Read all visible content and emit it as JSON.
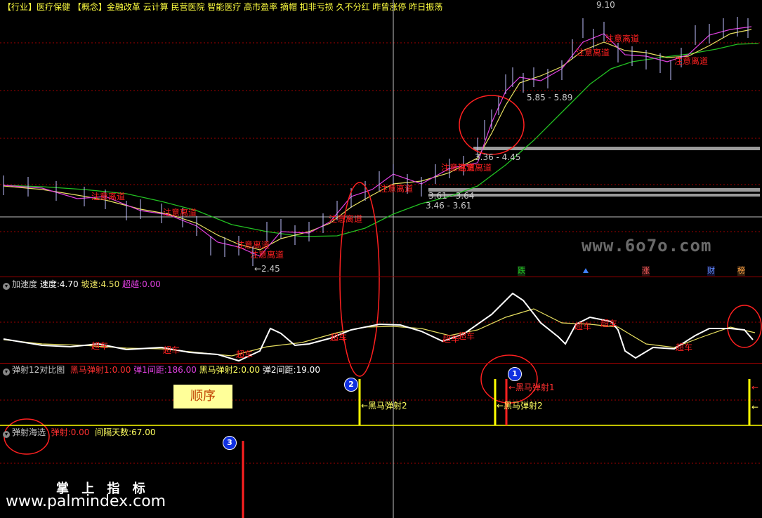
{
  "header": {
    "industry_tag": "【行业】",
    "industry": "医疗保健",
    "concept_tag": "【概念】",
    "concepts": "金融改革 云计算 民营医院 智能医疗 高市盈率 摘帽 扣非亏损 久不分红 昨曾涨停 昨日振荡"
  },
  "main_chart": {
    "price_labels": {
      "high": "9.10",
      "low": "←2.45",
      "zone1": "5.85 - 5.89",
      "zone2": "3.36 - 4.45",
      "zone3": "3.61 - 3.64",
      "zone4": "3.46 - 3.61"
    },
    "signal_labels": [
      "注意离道",
      "注意离道",
      "注意离道",
      "注意离道",
      "注意离道",
      "注意离道",
      "注意离道",
      "注意离道",
      "注意离道",
      "注意离道",
      "注意离道"
    ],
    "watermark": "www.6o7o.com",
    "markers": {
      "m1": "跌",
      "m2": "涨",
      "m3": "财",
      "m4": "榜"
    }
  },
  "pane_accel": {
    "name": "加速度",
    "speed_label": "速度:",
    "speed_value": "4.70",
    "slope_label": "坡速:",
    "slope_value": "4.50",
    "overtake_label": "超越:",
    "overtake_value": "0.00",
    "signal_label": "超车"
  },
  "pane_eject": {
    "name": "弹射12对比图",
    "h1_label": "黑马弹射1:",
    "h1_value": "0.00",
    "gap1_label": "弹1间距:",
    "gap1_value": "186.00",
    "h2_label": "黑马弹射2:",
    "h2_value": "0.00",
    "gap2_label": "弹2间距:",
    "gap2_value": "19.00",
    "annot_order": "顺序",
    "annot_h2a": "←黑马弹射2",
    "annot_h2b": "←黑马弹射2",
    "annot_h1": "←黑马弹射1"
  },
  "pane_sea": {
    "name": "弹射海选",
    "eject_label": "弹射:",
    "eject_value": "0.00",
    "days_label": "间隔天数:",
    "days_value": "67.00"
  },
  "badges": {
    "b1": "1",
    "b2": "2",
    "b3": "3"
  },
  "brand": {
    "cn": "掌 上 指 标",
    "url": "www.palmindex.com"
  },
  "colors": {
    "grid_red": "#a00000",
    "ma_green": "#22c022",
    "ma_yellow": "#e8e060",
    "ma_magenta": "#e040e0",
    "candle": "#c0c0ff",
    "signal_red": "#ff2020",
    "yellow_line": "#ffff00"
  }
}
